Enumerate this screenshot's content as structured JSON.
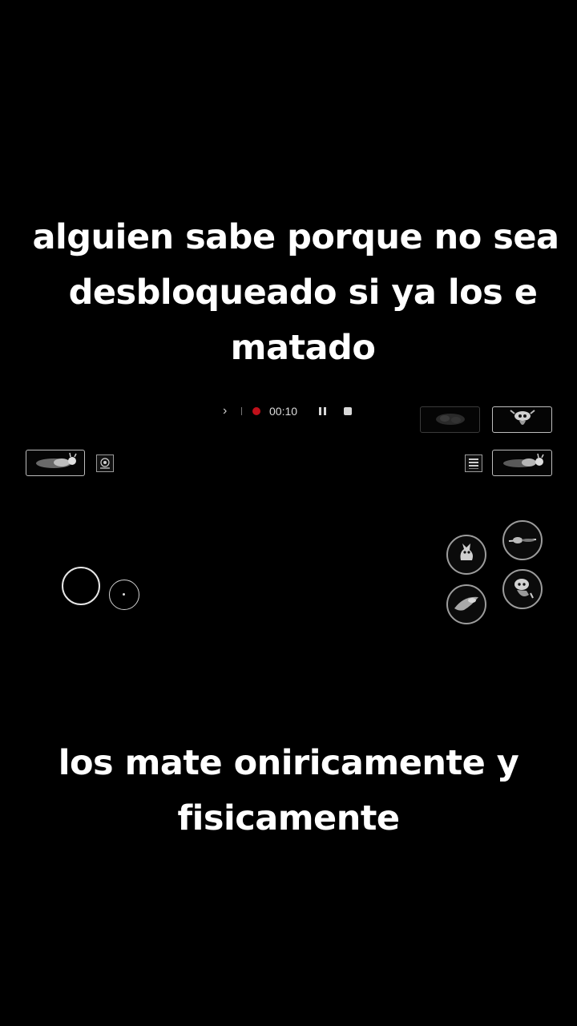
{
  "captions": {
    "top": [
      "alguien sabe porque no sea",
      "desbloqueado si ya los e",
      "matado"
    ],
    "bottom": [
      "los mate oniricamente y",
      "fisicamente"
    ]
  },
  "recorder": {
    "timer": "00:10",
    "record_color": "#c0101a",
    "icons": [
      "chevron-right-icon",
      "record-icon",
      "pause-icon",
      "stop-icon"
    ]
  },
  "hud": {
    "top_right_buttons": [
      "spell-icon-dim",
      "vengeful-spirit-icon"
    ],
    "left_buttons": [
      "dash-icon",
      "map-icon"
    ],
    "right_buttons": [
      "menu-icon",
      "fireball-icon"
    ],
    "action_buttons": [
      "jump-icon",
      "attack-icon",
      "dash-action-icon",
      "focus-icon"
    ],
    "joystick": [
      "joystick-base",
      "joystick-knob"
    ]
  }
}
